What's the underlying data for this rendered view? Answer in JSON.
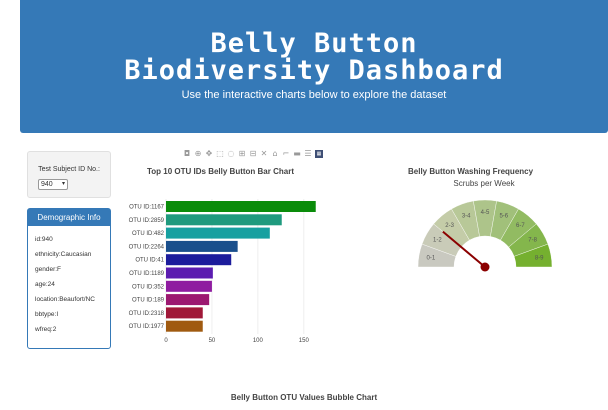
{
  "header": {
    "title_line1": "Belly Button",
    "title_line2": "Biodiversity Dashboard",
    "subtitle": "Use the interactive charts below to explore the dataset"
  },
  "selector": {
    "label": "Test Subject ID No.:",
    "value": "940"
  },
  "demographic": {
    "title": "Demographic Info",
    "rows": [
      "id:940",
      "ethnicity:Caucasian",
      "gender:F",
      "age:24",
      "location:Beaufort/NC",
      "bbtype:I",
      "wfreq:2"
    ]
  },
  "modebar_icons": [
    "camera-icon",
    "zoom-icon",
    "pan-icon",
    "box-select-icon",
    "lasso-icon",
    "zoom-in-icon",
    "zoom-out-icon",
    "autoscale-icon",
    "home-icon",
    "spike-icon",
    "hover-closest-icon",
    "hover-compare-icon",
    "plotly-logo-icon"
  ],
  "chart_data": [
    {
      "type": "bar",
      "orientation": "horizontal",
      "title": "Top 10 OTU IDs Belly Button Bar Chart",
      "categories": [
        "OTU ID:1167",
        "OTU ID:2859",
        "OTU ID:482",
        "OTU ID:2264",
        "OTU ID:41",
        "OTU ID:1189",
        "OTU ID:352",
        "OTU ID:189",
        "OTU ID:2318",
        "OTU ID:1977"
      ],
      "values": [
        163,
        126,
        113,
        78,
        71,
        51,
        50,
        47,
        40,
        40
      ],
      "colors": [
        "#0a8c0a",
        "#1f9a7e",
        "#17a0a0",
        "#1a4f8c",
        "#1c1c9c",
        "#5b1cb0",
        "#8f1ca0",
        "#9c1870",
        "#a01838",
        "#a05a10"
      ],
      "xticks": [
        0,
        50,
        100,
        150
      ],
      "xlim": [
        0,
        172
      ]
    },
    {
      "type": "gauge",
      "title": "Belly Button Washing Frequency",
      "subtitle": "Scrubs per Week",
      "segments": [
        "0-1",
        "1-2",
        "2-3",
        "3-4",
        "4-5",
        "5-6",
        "6-7",
        "7-8",
        "8-9"
      ],
      "segment_colors": [
        "#c9c9c0",
        "#c9cbb8",
        "#c4cca8",
        "#b8c898",
        "#adc48a",
        "#a1c07a",
        "#92bb62",
        "#84b64c",
        "#75b02f"
      ],
      "range": [
        0,
        9
      ],
      "value": 2,
      "needle_color": "#8b0000"
    }
  ],
  "bubble_chart": {
    "title": "Belly Button OTU Values Bubble Chart"
  }
}
